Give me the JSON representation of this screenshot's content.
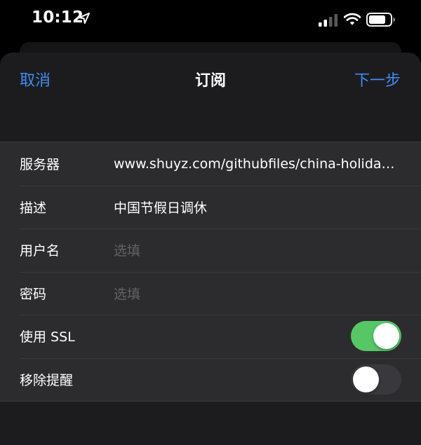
{
  "status_bar": {
    "time": "10:12",
    "icons": [
      "location-arrow-icon",
      "cellular-signal-icon",
      "wifi-icon",
      "battery-icon"
    ]
  },
  "nav": {
    "cancel_label": "取消",
    "title": "订阅",
    "next_label": "下一步"
  },
  "form": {
    "server": {
      "label": "服务器",
      "value": "www.shuyz.com/githubfiles/china-holiday-calender/master/holidayCal.ics"
    },
    "description": {
      "label": "描述",
      "value": "中国节假日调休"
    },
    "username": {
      "label": "用户名",
      "placeholder": "选填"
    },
    "password": {
      "label": "密码",
      "placeholder": "选填"
    },
    "use_ssl": {
      "label": "使用 SSL",
      "on": true
    },
    "remove_alerts": {
      "label": "移除提醒",
      "on": false
    }
  },
  "colors": {
    "accent": "#3f8ef3",
    "toggle_on": "#57c765",
    "sheet_bg": "#1c1c1e",
    "group_bg": "#2c2c2e"
  }
}
